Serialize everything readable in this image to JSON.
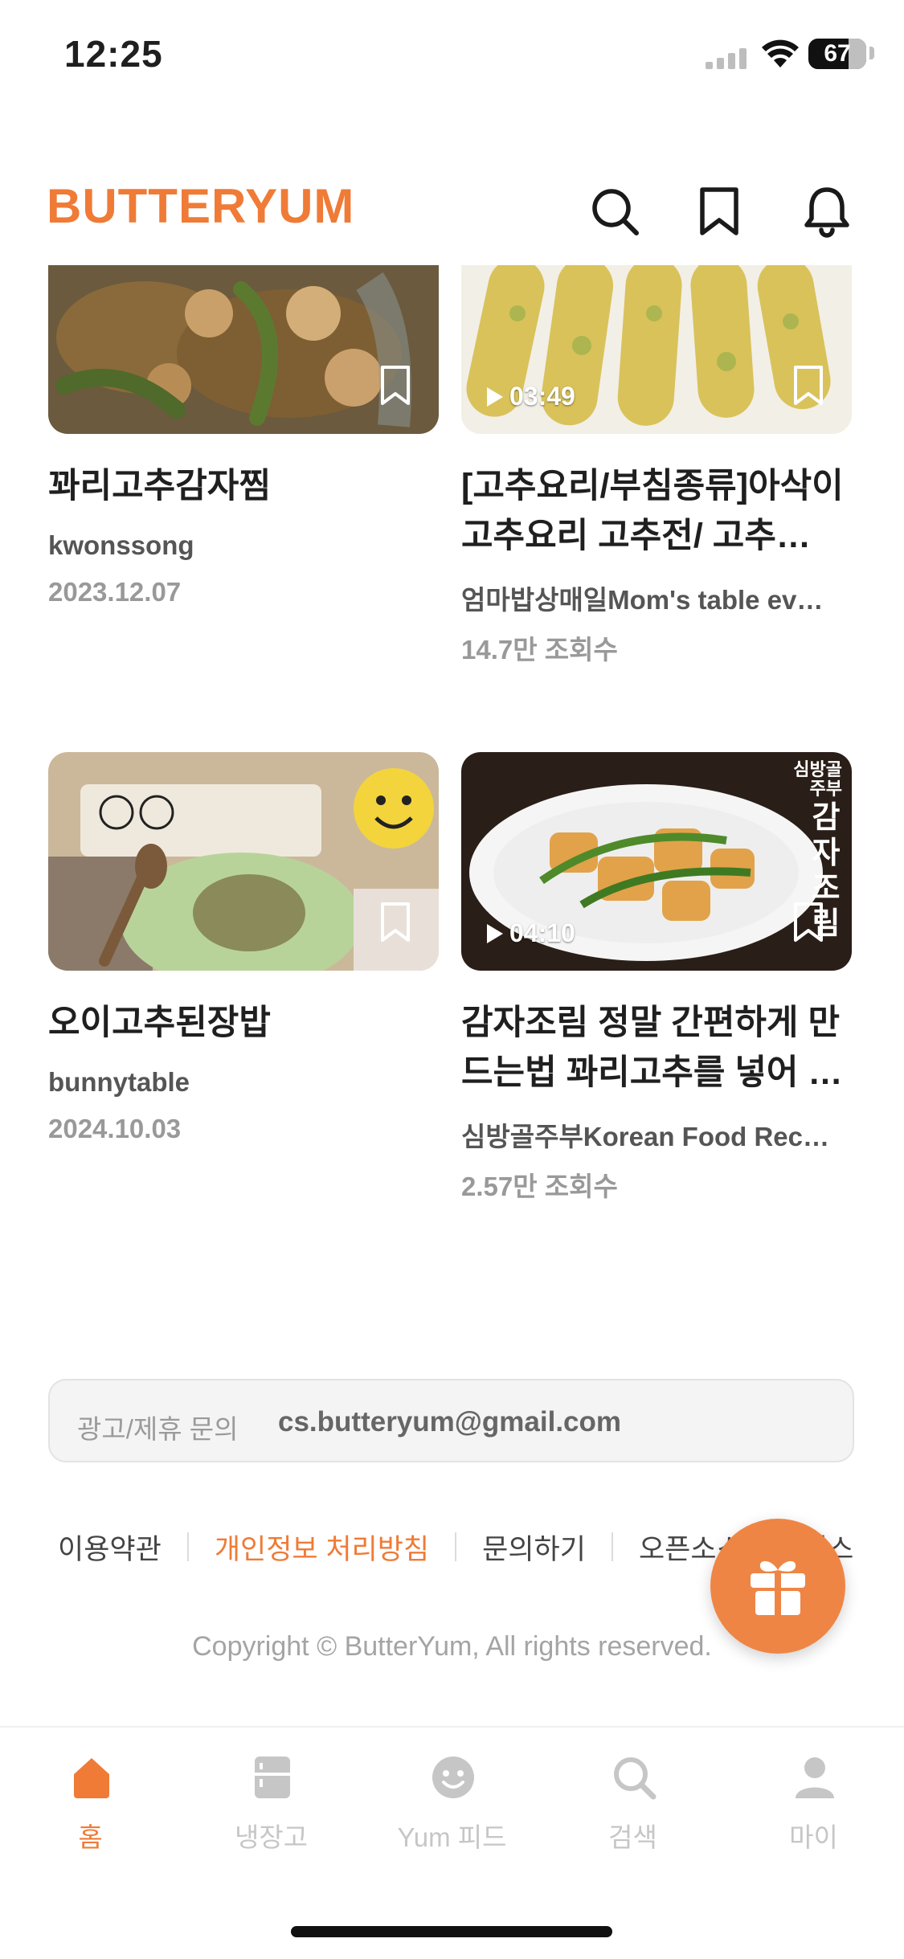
{
  "status_bar": {
    "time": "12:25",
    "battery": "67"
  },
  "header": {
    "logo": "BUTTERYUM",
    "icons": [
      "search-icon",
      "bookmark-icon",
      "bell-icon"
    ]
  },
  "feed": [
    {
      "title": "꽈리고추감자찜",
      "author": "kwonssong",
      "date": "2023.12.07",
      "duration": ""
    },
    {
      "title": "[고추요리/부침종류]아삭이고추요리 고추전/ 고추…",
      "author": "엄마밥상매일Mom's table ev…",
      "views": "14.7만 조회수",
      "duration": "03:49"
    },
    {
      "title": "오이고추된장밥",
      "author": "bunnytable",
      "date": "2024.10.03",
      "duration": ""
    },
    {
      "title": "감자조림 정말 간편하게 만드는법 꽈리고추를 넣어 …",
      "author": "심방골주부Korean Food Rec…",
      "views": "2.57만 조회수",
      "duration": "04:10",
      "overlay_caption": "심방골 주부",
      "overlay_title": "감자조림"
    }
  ],
  "contact": {
    "label": "광고/제휴 문의",
    "email": "cs.butteryum@gmail.com"
  },
  "footer_links": [
    "이용약관",
    "개인정보 처리방침",
    "문의하기",
    "오픈소스 라이선스"
  ],
  "copyright": "Copyright © ButterYum, All rights reserved.",
  "bottom_nav": [
    {
      "label": "홈",
      "icon": "home-icon",
      "active": true
    },
    {
      "label": "냉장고",
      "icon": "fridge-icon",
      "active": false
    },
    {
      "label": "Yum 피드",
      "icon": "smile-icon",
      "active": false
    },
    {
      "label": "검색",
      "icon": "search-icon",
      "active": false
    },
    {
      "label": "마이",
      "icon": "person-icon",
      "active": false
    }
  ],
  "colors": {
    "accent": "#ef7b37",
    "nav_inactive": "#c6c6c6"
  }
}
